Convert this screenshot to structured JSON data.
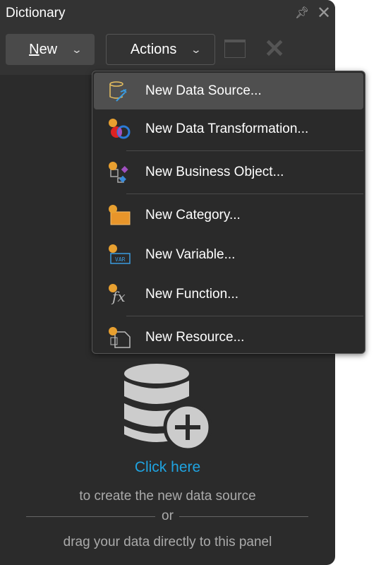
{
  "panel": {
    "title": "Dictionary"
  },
  "toolbar": {
    "new_label": "New",
    "new_underline": "N",
    "new_rest": "ew",
    "actions_label": "Actions"
  },
  "menu": {
    "items": [
      {
        "label": "New Data Source...",
        "icon": "data-source-icon"
      },
      {
        "label": "New Data Transformation...",
        "icon": "data-transformation-icon"
      },
      {
        "label": "New Business Object...",
        "icon": "business-object-icon"
      },
      {
        "label": "New Category...",
        "icon": "category-folder-icon"
      },
      {
        "label": "New Variable...",
        "icon": "variable-icon"
      },
      {
        "label": "New Function...",
        "icon": "function-icon"
      },
      {
        "label": "New Resource...",
        "icon": "resource-icon"
      }
    ]
  },
  "empty": {
    "link": "Click here",
    "line1": "to create the new data source",
    "or": "or",
    "line2": "drag your data directly to this panel"
  },
  "colors": {
    "accent": "#1fa3e0",
    "badge": "#e8a030"
  }
}
